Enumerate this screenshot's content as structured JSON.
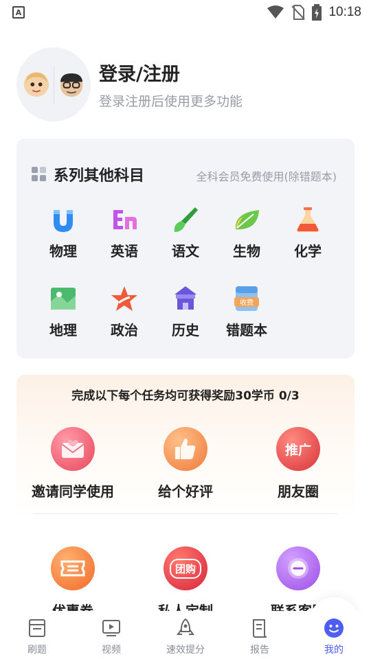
{
  "status": {
    "time": "10:18"
  },
  "profile": {
    "title": "登录/注册",
    "subtitle": "登录注册后使用更多功能"
  },
  "subjects": {
    "title": "系列其他科目",
    "note": "全科会员免费使用(除错题本)",
    "items": [
      {
        "label": "物理",
        "icon": "magnet-icon",
        "color": "#2f8cf0"
      },
      {
        "label": "英语",
        "icon": "en-icon",
        "color": "#c454e8"
      },
      {
        "label": "语文",
        "icon": "brush-icon",
        "color": "#3fb84a"
      },
      {
        "label": "生物",
        "icon": "leaf-icon",
        "color": "#6cc84a"
      },
      {
        "label": "化学",
        "icon": "flask-icon",
        "color": "#f07050"
      },
      {
        "label": "地理",
        "icon": "map-icon",
        "color": "#4cba6c"
      },
      {
        "label": "政治",
        "icon": "star-icon",
        "color": "#ef5a3a"
      },
      {
        "label": "历史",
        "icon": "building-icon",
        "color": "#6a56d8"
      },
      {
        "label": "错题本",
        "icon": "paid-book-icon",
        "color": "#5aa0e8",
        "badge": "收费"
      }
    ]
  },
  "tasks": {
    "title": "完成以下每个任务均可获得奖励30学币 0/3",
    "items": [
      {
        "label": "邀请同学使用",
        "icon": "invite-icon"
      },
      {
        "label": "给个好评",
        "icon": "thumbs-up-icon"
      },
      {
        "label": "朋友圈",
        "icon": "promote-icon",
        "badge": "推广"
      },
      {
        "label": "优惠券",
        "icon": "coupon-icon"
      },
      {
        "label": "私人定制",
        "icon": "group-buy-icon",
        "badge": "团购"
      },
      {
        "label": "联系客服",
        "icon": "chat-icon"
      }
    ]
  },
  "nav": {
    "items": [
      {
        "label": "刷题",
        "icon": "exercise-icon"
      },
      {
        "label": "视频",
        "icon": "video-icon"
      },
      {
        "label": "速效提分",
        "icon": "rocket-icon"
      },
      {
        "label": "报告",
        "icon": "report-icon"
      },
      {
        "label": "我的",
        "icon": "smile-icon",
        "active": true
      }
    ]
  },
  "colors": {
    "accent": "#4d5ef0"
  }
}
